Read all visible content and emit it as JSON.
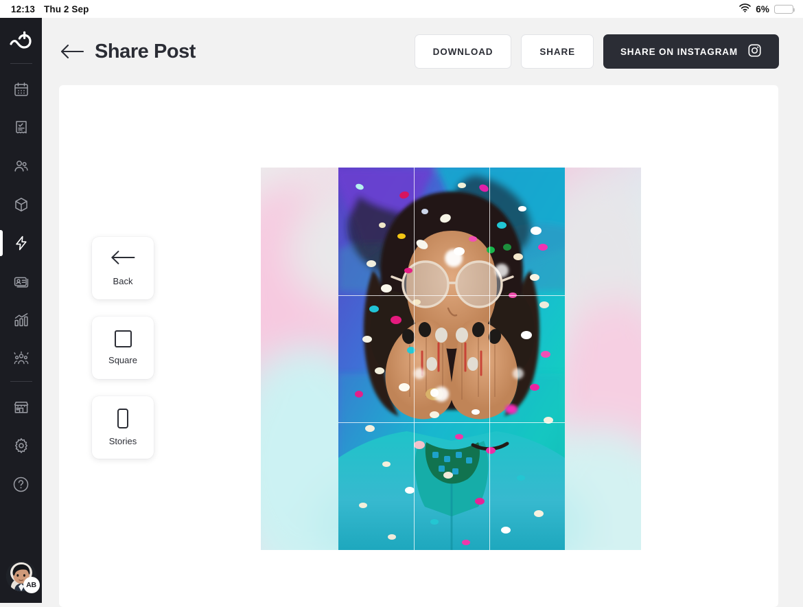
{
  "statusbar": {
    "time": "12:13",
    "date": "Thu 2 Sep",
    "battery_percent": "6%",
    "battery_level": 6,
    "wifi_icon": "wifi-icon",
    "battery_icon": "battery-icon"
  },
  "sidebar": {
    "logo_name": "bookee-logo",
    "items": [
      {
        "name": "sidebar-item-calendar",
        "icon": "calendar-icon",
        "active": false
      },
      {
        "name": "sidebar-item-invoices",
        "icon": "receipt-check-icon",
        "active": false
      },
      {
        "name": "sidebar-item-clients",
        "icon": "people-icon",
        "active": false
      },
      {
        "name": "sidebar-item-packages",
        "icon": "box-icon",
        "active": false
      },
      {
        "name": "sidebar-item-marketing",
        "icon": "lightning-bolt-icon",
        "active": true
      },
      {
        "name": "sidebar-item-memberships",
        "icon": "id-card-icon",
        "active": false
      },
      {
        "name": "sidebar-item-reports",
        "icon": "bar-chart-icon",
        "active": false
      },
      {
        "name": "sidebar-item-staff",
        "icon": "team-icon",
        "active": false
      },
      {
        "name": "sidebar-item-store",
        "icon": "store-icon",
        "active": false
      },
      {
        "name": "sidebar-item-settings",
        "icon": "gear-icon",
        "active": false
      },
      {
        "name": "sidebar-item-help",
        "icon": "question-circle-icon",
        "active": false
      }
    ],
    "avatar": {
      "name": "user-avatar",
      "badge_initials": "AB"
    }
  },
  "header": {
    "back_icon": "arrow-left-icon",
    "title": "Share Post",
    "buttons": {
      "download": "DOWNLOAD",
      "share": "SHARE",
      "share_instagram": "SHARE ON INSTAGRAM",
      "instagram_icon": "instagram-icon"
    }
  },
  "options": [
    {
      "name": "option-back",
      "label": "Back",
      "icon": "arrow-left-icon"
    },
    {
      "name": "option-square",
      "label": "Square",
      "icon": "square-icon"
    },
    {
      "name": "option-stories",
      "label": "Stories",
      "icon": "phone-portrait-icon"
    }
  ],
  "preview": {
    "name": "post-preview",
    "description": "Woman with curly dark hair and round glasses blowing colorful confetti from her hands, wearing a denim jacket, against a blurred pastel teal and pink background",
    "grid_overlay": true,
    "grid_rows": 3,
    "grid_columns": 3
  },
  "colors": {
    "sidebar_bg": "#1b1c22",
    "page_bg": "#f2f2f2",
    "card_bg": "#ffffff",
    "text_dark": "#2b2d35",
    "primary_button_bg": "#2b2d35",
    "battery_low": "#f8523a"
  }
}
